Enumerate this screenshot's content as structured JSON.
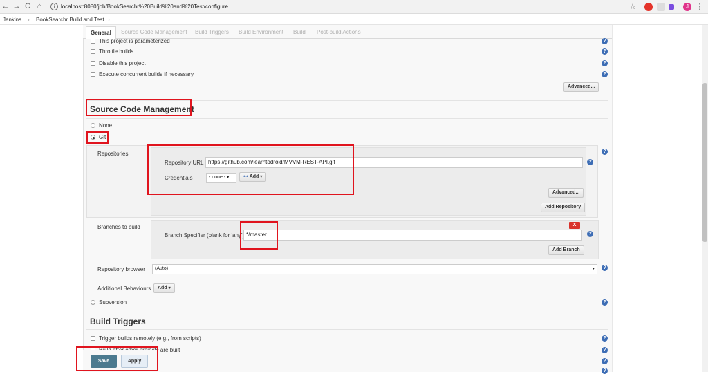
{
  "browser": {
    "url": "localhost:8080/job/BookSearchr%20Build%20and%20Test/configure",
    "nav_back": "←",
    "nav_forward": "→",
    "nav_reload": "C",
    "nav_home": "⌂",
    "info_icon": "i",
    "star_icon": "☆",
    "profile_initial": "J",
    "menu_icon": "⋮"
  },
  "breadcrumb": {
    "root": "Jenkins",
    "sep1": "›",
    "job": "BookSearchr Build and Test",
    "sep2": "›"
  },
  "tabs": [
    "General",
    "Source Code Management",
    "Build Triggers",
    "Build Environment",
    "Build",
    "Post-build Actions"
  ],
  "general": {
    "parameterized": "This project is parameterized",
    "throttle": "Throttle builds",
    "disable": "Disable this project",
    "concurrent": "Execute concurrent builds if necessary",
    "advanced_button": "Advanced..."
  },
  "scm": {
    "title": "Source Code Management",
    "none_label": "None",
    "git_label": "Git",
    "repositories_label": "Repositories",
    "repository_url_label": "Repository URL",
    "repository_url_value": "https://github.com/learntodroid/MVVM-REST-API.git",
    "credentials_label": "Credentials",
    "credentials_value": "- none -",
    "add_credentials_button": "Add",
    "advanced_button": "Advanced...",
    "add_repository_button": "Add Repository",
    "branches_label": "Branches to build",
    "branch_specifier_label": "Branch Specifier (blank for 'any')",
    "branch_specifier_value": "*/master",
    "delete_branch_button": "X",
    "add_branch_button": "Add Branch",
    "repo_browser_label": "Repository browser",
    "repo_browser_value": "(Auto)",
    "additional_behaviours_label": "Additional Behaviours",
    "add_behaviour_button": "Add",
    "subversion_label": "Subversion"
  },
  "build_triggers": {
    "title": "Build Triggers",
    "remote": "Trigger builds remotely (e.g., from scripts)",
    "after_other": "Build after other projects are built",
    "partial": "...ore built"
  },
  "actions": {
    "save": "Save",
    "apply": "Apply"
  },
  "colors": {
    "highlight": "#e0141e",
    "save_bg": "#4b7a8f",
    "help_icon": "#3d6db5"
  }
}
